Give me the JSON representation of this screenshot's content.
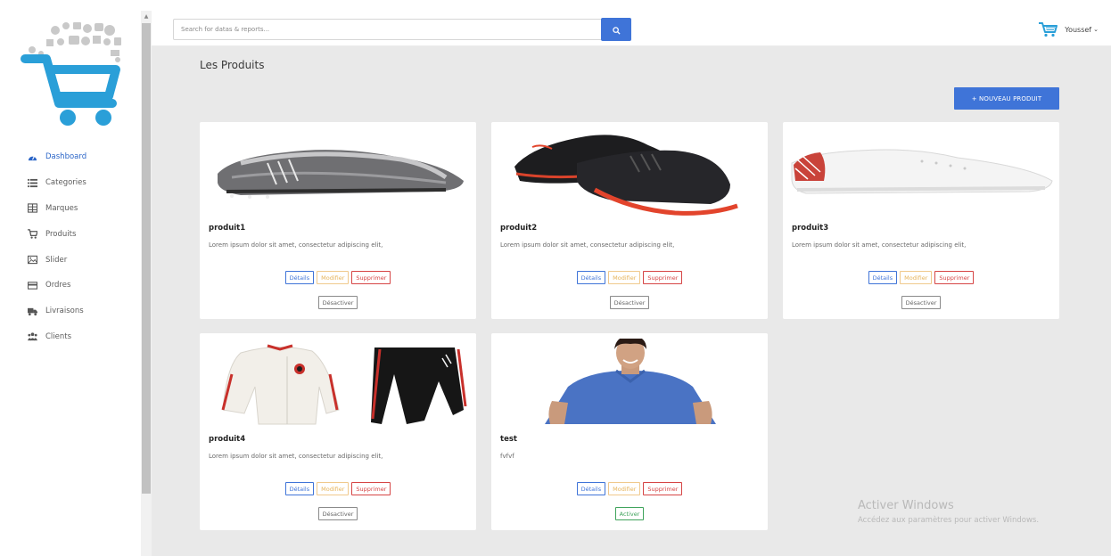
{
  "search": {
    "placeholder": "Search for datas & reports..."
  },
  "user": {
    "name": "Youssef",
    "caret": "⌄"
  },
  "sidebar": {
    "items": [
      {
        "label": "Dashboard",
        "icon": "dashboard-icon"
      },
      {
        "label": "Categories",
        "icon": "list-icon"
      },
      {
        "label": "Marques",
        "icon": "grid-icon"
      },
      {
        "label": "Produits",
        "icon": "cart-icon"
      },
      {
        "label": "Slider",
        "icon": "image-icon"
      },
      {
        "label": "Ordres",
        "icon": "card-icon"
      },
      {
        "label": "Livraisons",
        "icon": "truck-icon"
      },
      {
        "label": "Clients",
        "icon": "users-icon"
      }
    ]
  },
  "main": {
    "title": "Les Produits",
    "new_button": "+ NOUVEAU PRODUIT",
    "products": [
      {
        "name": "produit1",
        "description": "Lorem ipsum dolor sit amet, consectetur adipiscing elit,",
        "toggle": "Désactiver"
      },
      {
        "name": "produit2",
        "description": "Lorem ipsum dolor sit amet, consectetur adipiscing elit,",
        "toggle": "Désactiver"
      },
      {
        "name": "produit3",
        "description": "Lorem ipsum dolor sit amet, consectetur adipiscing elit,",
        "toggle": "Désactiver"
      },
      {
        "name": "produit4",
        "description": "Lorem ipsum dolor sit amet, consectetur adipiscing elit,",
        "toggle": "Désactiver"
      },
      {
        "name": "test",
        "description": "fvfvf",
        "toggle": "Activer"
      }
    ],
    "actions": {
      "details": "Détails",
      "modifier": "Modifier",
      "supprimer": "Supprimer"
    }
  },
  "watermark": {
    "line1": "Activer Windows",
    "line2": "Accédez aux paramètres pour activer Windows."
  },
  "colors": {
    "accent": "#3f74d8",
    "logo_blue": "#2a9fd8",
    "danger": "#d64545",
    "warning": "#e6b35a",
    "success": "#3fa35b",
    "background": "#e9e9e9"
  }
}
